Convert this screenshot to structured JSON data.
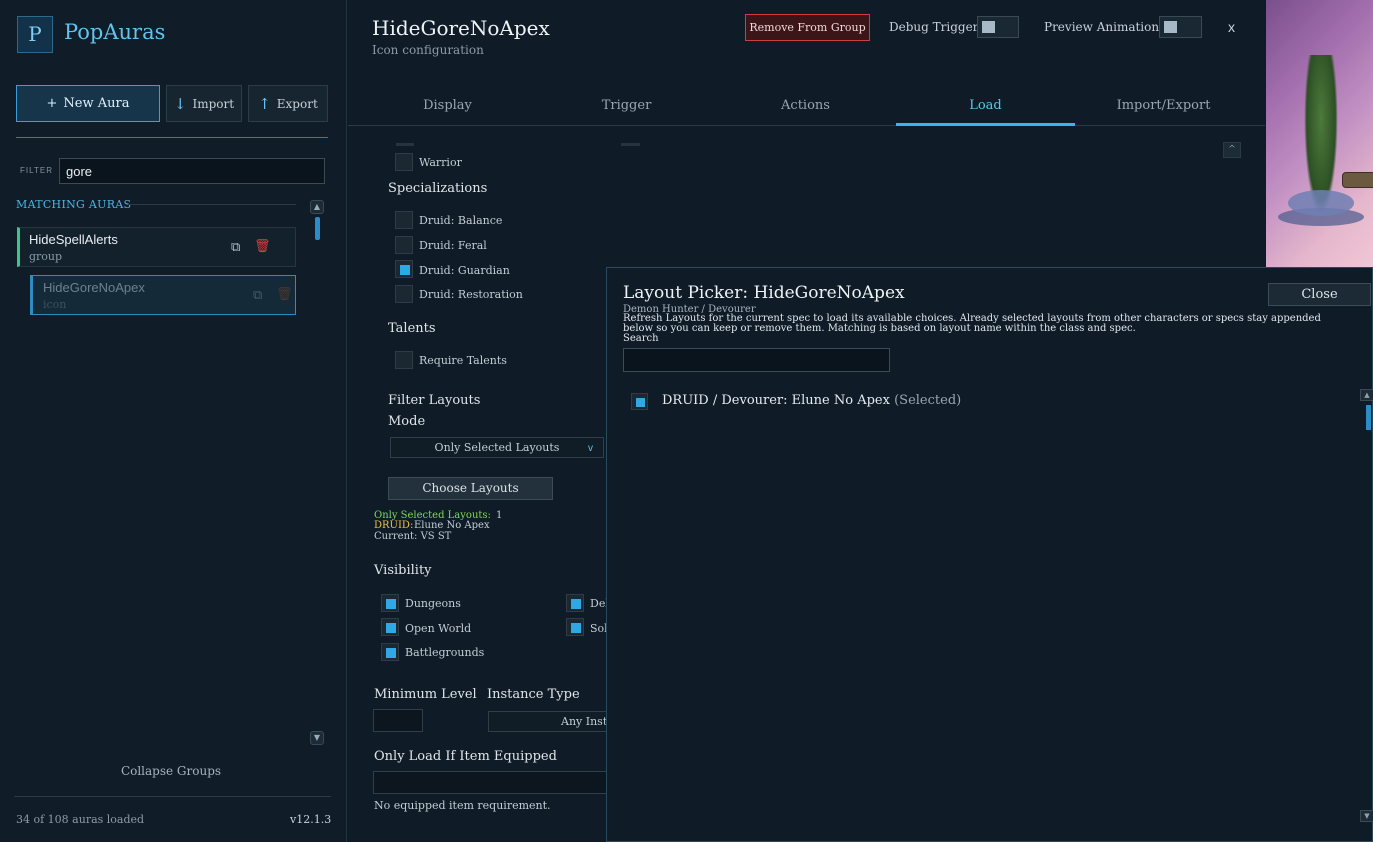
{
  "sidebar": {
    "logo_letter": "P",
    "app_title": "PopAuras",
    "new_aura_label": "New Aura",
    "new_aura_prefix": "+",
    "import_label": "Import",
    "export_label": "Export",
    "filter_label": "FILTER",
    "filter_value": "gore",
    "matching_label": "MATCHING AURAS",
    "auras": [
      {
        "name": "HideSpellAlerts",
        "type": "group"
      },
      {
        "name": "HideGoreNoApex",
        "type": "icon"
      }
    ],
    "collapse_groups_label": "Collapse Groups",
    "auras_loaded": "34 of 108 auras loaded",
    "version": "v12.1.3"
  },
  "header": {
    "title": "HideGoreNoApex",
    "subtitle": "Icon configuration",
    "remove_label": "Remove From Group",
    "debug_label": "Debug Trigger",
    "preview_label": "Preview Animation",
    "close_label": "x"
  },
  "tabs": [
    {
      "label": "Display"
    },
    {
      "label": "Trigger"
    },
    {
      "label": "Actions"
    },
    {
      "label": "Load"
    },
    {
      "label": "Import/Export"
    }
  ],
  "active_tab": "Load",
  "load": {
    "class_warrior": "Warrior",
    "specializations_title": "Specializations",
    "specs": [
      {
        "label": "Druid: Balance",
        "checked": false
      },
      {
        "label": "Druid: Feral",
        "checked": false
      },
      {
        "label": "Druid: Guardian",
        "checked": true
      },
      {
        "label": "Druid: Restoration",
        "checked": false
      }
    ],
    "talents_title": "Talents",
    "require_talents": "Require Talents",
    "filter_layouts_title": "Filter Layouts",
    "mode_label": "Mode",
    "mode_value": "Only Selected Layouts",
    "mode_caret": "v",
    "choose_layouts_label": "Choose Layouts",
    "selected_count_label": "Only Selected Layouts:",
    "selected_count_value": "1",
    "druid_label": "DRUID:",
    "druid_value": "Elune No Apex",
    "current_line": "Current: VS ST",
    "visibility_title": "Visibility",
    "visibility": [
      {
        "label": "Dungeons",
        "checked": true
      },
      {
        "label": "Open World",
        "checked": true
      },
      {
        "label": "Battlegrounds",
        "checked": true
      },
      {
        "label": "Del",
        "checked": true
      },
      {
        "label": "Sol",
        "checked": true
      }
    ],
    "min_level_label": "Minimum Level",
    "instance_type_label": "Instance Type",
    "instance_type_value": "Any Insta",
    "item_equipped_label": "Only Load If Item Equipped",
    "item_equipped_note": "No equipped item requirement."
  },
  "picker": {
    "title": "Layout Picker: HideGoreNoApex",
    "close_label": "Close",
    "spec": "Demon Hunter / Devourer",
    "description": "Refresh Layouts for the current spec to load its available choices. Already selected layouts from other characters or specs stay appended below so you can keep or remove them. Matching is based on layout name within the class and spec.",
    "search_label": "Search",
    "layouts": [
      {
        "name": "DRUID / Devourer: Elune No Apex",
        "status": "(Selected)",
        "checked": true
      }
    ]
  },
  "icons": {
    "import": "arrow-down-icon",
    "export": "arrow-up-icon",
    "duplicate": "duplicate-icon",
    "delete": "trash-icon"
  },
  "colors": {
    "accent": "#3db3ea",
    "danger": "#c94040",
    "group_marker": "#38c98a"
  }
}
